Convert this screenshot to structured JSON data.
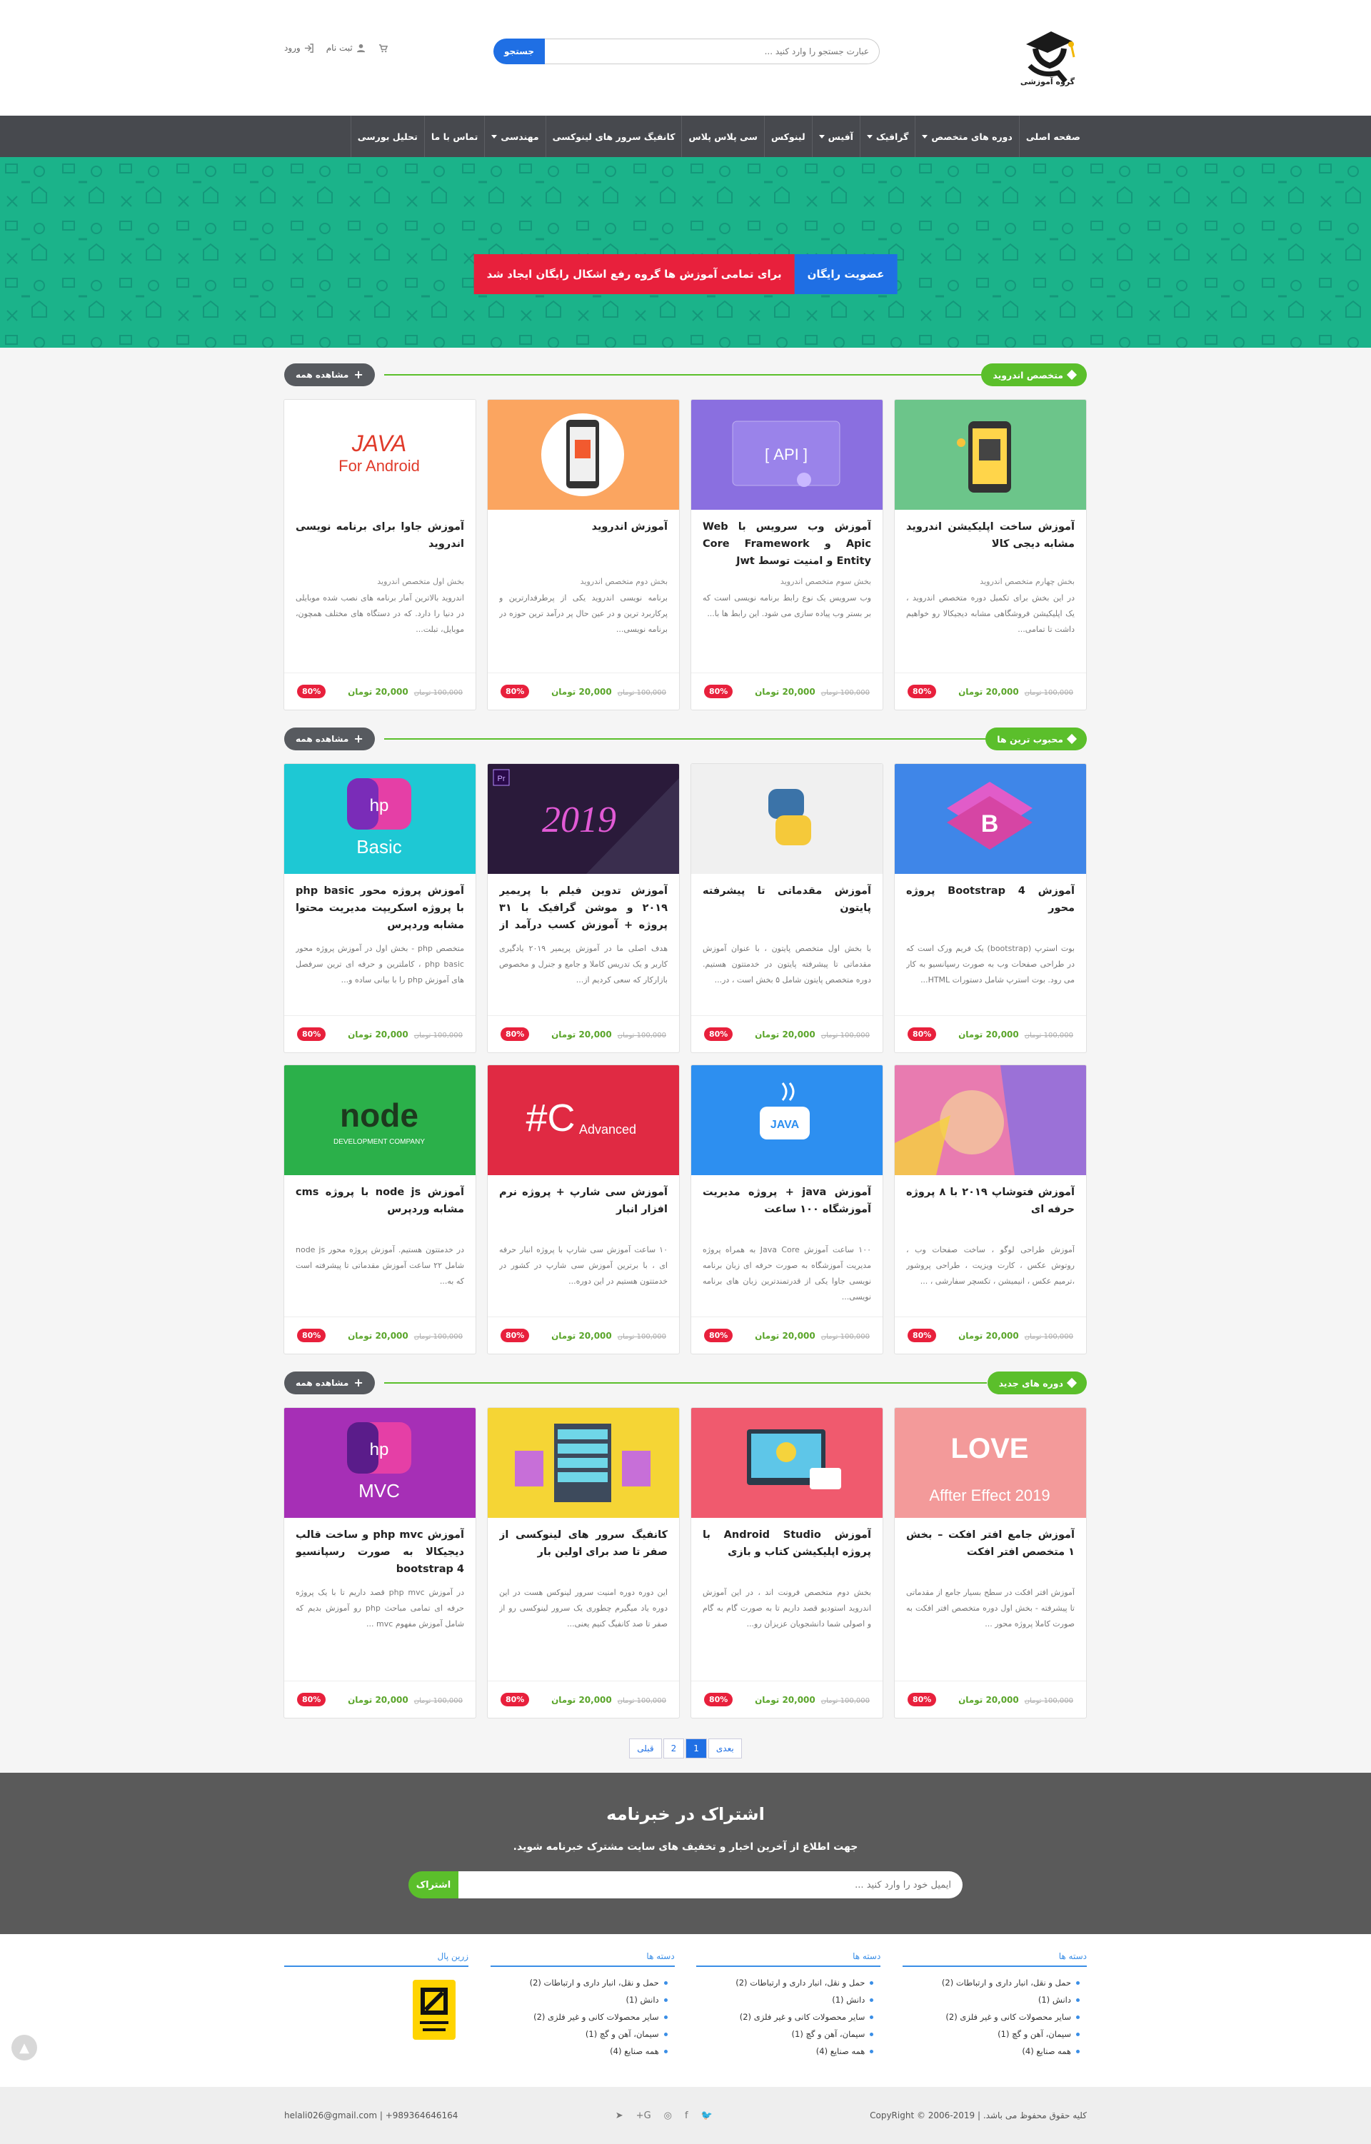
{
  "header": {
    "logo_text": "گروه آموزشی",
    "search_placeholder": "عبارت جستجو را وارد کنید ...",
    "search_button": "جستجو",
    "login": "ورود",
    "register": "ثبت نام"
  },
  "nav": [
    {
      "label": "صفحه اصلی",
      "dropdown": false
    },
    {
      "label": "دوره های متخصص",
      "dropdown": true
    },
    {
      "label": "گرافیک",
      "dropdown": true
    },
    {
      "label": "آفیس",
      "dropdown": true
    },
    {
      "label": "لینوکس",
      "dropdown": false
    },
    {
      "label": "سی پلاس پلاس",
      "dropdown": false
    },
    {
      "label": "کانفیگ سرور های لینوکسی",
      "dropdown": false
    },
    {
      "label": "مهندسی",
      "dropdown": true
    },
    {
      "label": "تماس با ما",
      "dropdown": false
    },
    {
      "label": "تحلیل بورسی",
      "dropdown": false
    }
  ],
  "promo": {
    "text": "برای تمامی آموزش ها گروه رفع اشکال رایگان ایجاد شد",
    "button": "عضویت رایگان"
  },
  "view_all": "مشاهده همه",
  "sections": [
    {
      "title": "متخصص اندروید",
      "cards": [
        {
          "title": "آموزش ساخت اپلیکیشن اندروید مشابه دیجی کالا",
          "sub": "بخش چهارم متخصص اندروید",
          "desc": "در این بخش برای تکمیل دوره متخصص اندروید ، یک اپلیکیشن فروشگاهی مشابه دیجیکالا رو خواهیم داشت تا تمامی...",
          "badge": "80%",
          "old": "100,000 تومان",
          "price": "20,000 تومان",
          "img": "android",
          "bg": "#6cc58a"
        },
        {
          "title": "آموزش وب سرویس با Web Apic و Core Framework Entity و امنیت توسط Jwt",
          "sub": "بخش سوم متخصص اندروید",
          "desc": "وب سرویس یک نوع رابط برنامه نویسی است که بر بستر وب پیاده سازی می شود. این رابط ها با...",
          "badge": "80%",
          "old": "100,000 تومان",
          "price": "20,000 تومان",
          "img": "api",
          "bg": "#8a6fe0"
        },
        {
          "title": "آموزش اندروید",
          "sub": "بخش دوم متخصص اندروید",
          "desc": "برنامه نویسی اندروید یکی از پرطرفدارترین و پرکاربرد ترین و در عین حال پر درآمد ترین حوزه در برنامه نویسی...",
          "badge": "80%",
          "old": "100,000 تومان",
          "price": "20,000 تومان",
          "img": "phone",
          "bg": "#fba560"
        },
        {
          "title": "آموزش جاوا برای برنامه نویسی اندروید",
          "sub": "بخش اول متخصص اندروید",
          "desc": "اندروید بالاترین آمار برنامه های نصب شده موبایلی در دنیا را دارد. که در دستگاه های مختلف همچون، موبایل، تبلت...",
          "badge": "80%",
          "old": "100,000 تومان",
          "price": "20,000 تومان",
          "img": "java",
          "bg": "#ffffff"
        }
      ]
    },
    {
      "title": "محبوب ترین ها",
      "cards": [
        {
          "title": "آموزش Bootstrap 4 پروژه محور",
          "sub": "",
          "desc": "بوت استرپ (bootstrap) یک فریم ورک است که در طراحی صفحات وب به صورت رسپانسیو به کار می رود. بوت استرپ شامل دستورات HTML...",
          "badge": "80%",
          "old": "100,000 تومان",
          "price": "20,000 تومان",
          "img": "bootstrap",
          "bg": "#3f86e8"
        },
        {
          "title": "آموزش مقدماتی تا پیشرفته پایتون",
          "sub": "",
          "desc": "با بخش اول متخصص پایتون ، با عنوان آموزش مقدماتی تا پیشرفته پایتون در خدمتتون هستیم. دوره متخصص پایتون شامل ۵ بخش است ، در...",
          "badge": "80%",
          "old": "100,000 تومان",
          "price": "20,000 تومان",
          "img": "python",
          "bg": "#f0f0f0"
        },
        {
          "title": "آموزش تدوین فیلم با پریمیر ۲۰۱۹ و موشن گرافیک با ۳۱ پروژه + آموزش کسب درآمد از اینترنت",
          "sub": "",
          "desc": "هدف اصلی ما در آموزش پریمیر ۲۰۱۹ یادگیری کاربر و یک تدریس کاملا و جامع و جنرل و مخصوص بازارکار که سعی کردیم از...",
          "badge": "80%",
          "old": "100,000 تومان",
          "price": "20,000 تومان",
          "img": "premiere",
          "bg": "#2a1a3a"
        },
        {
          "title": "آموزش پروژه محور php basic با پروژه اسکریپت مدیریت محتوا مشابه وردپرس",
          "sub": "",
          "desc": "متخصص php - بخش اول در آموزش پروژه محور php basic ، کاملترین و حرفه ای ترین سرفصل های آموزش php را با بیانی ساده و...",
          "badge": "80%",
          "old": "100,000 تومان",
          "price": "20,000 تومان",
          "img": "phpbasic",
          "bg": "#1ec8d4"
        },
        {
          "title": "آموزش فتوشاپ ۲۰۱۹ با ۸ پروژه حرفه ای",
          "sub": "",
          "desc": "آموزش طراحی لوگو ، ساخت صفحات وب ، روتوش عکس ، کارت ویزیت ، طراحی پروشور ،ترمیم عکس ، انیمیشن ، تکسچر سفارشی ، ...",
          "badge": "80%",
          "old": "100,000 تومان",
          "price": "20,000 تومان",
          "img": "photoshop",
          "bg": "#e87bb0"
        },
        {
          "title": "آموزش java + پروژه مدیریت آموزشگاه ۱۰۰ ساعت",
          "sub": "",
          "desc": "۱۰۰ ساعت آموزش Java Core به همراه پروژه مدیریت آموزشگاه به صورت حرفه ای زبان برنامه نویسی جاوا یکی از قدرتمندترین زبان های برنامه نویسی...",
          "badge": "80%",
          "old": "100,000 تومان",
          "price": "20,000 تومان",
          "img": "javacup",
          "bg": "#2d8ff0"
        },
        {
          "title": "آموزش سی شارپ + پروژه نرم افزار انبار",
          "sub": "",
          "desc": "۱۰ ساعت آموزش سی شارپ با پروژه انبار حرفه ای ، با برترین آموزش سی شارپ در کشور در خدمتتون هستیم در این دوره...",
          "badge": "80%",
          "old": "100,000 تومان",
          "price": "20,000 تومان",
          "img": "csharp",
          "bg": "#e02a43"
        },
        {
          "title": "آموزش node js با پروژه cms مشابه وردپرس",
          "sub": "",
          "desc": "در خدمتتون هستیم. آموزش پروژه محور node js شامل ۲۲ ساعت آموزش مقدماتی تا پیشرفته است که به...",
          "badge": "80%",
          "old": "100,000 تومان",
          "price": "20,000 تومان",
          "img": "node",
          "bg": "#2bb04a"
        }
      ]
    },
    {
      "title": "دوره های جدید",
      "cards": [
        {
          "title": "آموزش جامع افتر افکت – بخش ۱ متخصص افتر افکت",
          "sub": "",
          "desc": "آموزش افتر افکت در سطح بسیار جامع از مقدماتی تا پیشرفته - بخش اول دوره متخصص افتر افکت به صورت کاملا پروژه محور ...",
          "badge": "80%",
          "old": "100,000 تومان",
          "price": "20,000 تومان",
          "img": "ae",
          "bg": "#f39a9a"
        },
        {
          "title": "آموزش Android Studio با پروژه اپلیکیشن کتاب و بازی",
          "sub": "",
          "desc": "بخش دوم متخصص فرونت اند ، در این آموزش اندروید استودیو قصد داریم تا به صورت گام به گام و اصولی شما دانشجویان عزیزان رو...",
          "badge": "80%",
          "old": "100,000 تومان",
          "price": "20,000 تومان",
          "img": "studio",
          "bg": "#f05a6e"
        },
        {
          "title": "کانفیگ سرور های لینوکسی از صفر تا صد برای اولین بار",
          "sub": "",
          "desc": "این دوره دوره امنیت سرور لینوکس هست در این دوره یاد میگیرم چطوری یک سرور لینوکسی رو از صفر تا صد کانفیگ کنیم یعنی...",
          "badge": "80%",
          "old": "100,000 تومان",
          "price": "20,000 تومان",
          "img": "server",
          "bg": "#f5d535"
        },
        {
          "title": "آموزش php mvc و ساخت قالب دیجیکالا به صورت رسپانسیو bootstrap 4",
          "sub": "",
          "desc": "در آموزش php mvc قصد داریم تا با یک پروژه حرفه ای تمامی مباحث php رو آموزش بدیم که شامل آموزش مفهوم mvc ...",
          "badge": "80%",
          "old": "100,000 تومان",
          "price": "20,000 تومان",
          "img": "phpmvc",
          "bg": "#a62fb6"
        }
      ]
    }
  ],
  "pager": {
    "next": "بعدی",
    "p1": "1",
    "p2": "2",
    "prev": "قبلی"
  },
  "newsletter": {
    "title": "اشتراک در خبرنامه",
    "desc": "جهت اطلاع از آخرین اخبار و تخفیف های سایت مشترک خبرنامه شوید.",
    "placeholder": "ایمیل خود را وارد کنید ...",
    "button": "اشتراک"
  },
  "footer_cols": [
    {
      "title": "دسته ها",
      "items": [
        "حمل و نقل، انبار داری و ارتباطات (2)",
        "دانش (1)",
        "سایر محصولات کانی و غیر فلزی (2)",
        "سیمان، آهن و گچ (1)",
        "همه صنایع (4)"
      ]
    },
    {
      "title": "دسته ها",
      "items": [
        "حمل و نقل، انبار داری و ارتباطات (2)",
        "دانش (1)",
        "سایر محصولات کانی و غیر فلزی (2)",
        "سیمان، آهن و گچ (1)",
        "همه صنایع (4)"
      ]
    },
    {
      "title": "دسته ها",
      "items": [
        "حمل و نقل، انبار داری و ارتباطات (2)",
        "دانش (1)",
        "سایر محصولات کانی و غیر فلزی (2)",
        "سیمان، آهن و گچ (1)",
        "همه صنایع (4)"
      ]
    },
    {
      "title": "زرین پال",
      "items": []
    }
  ],
  "footer": {
    "copyright": "کلیه حقوق محفوظ می باشد. | CopyRight © 2006-2019",
    "contact": "helali026@gmail.com | +989364646164"
  },
  "colors": {
    "green": "#5bbf2b",
    "red": "#e8203c",
    "blue": "#1f6fe4",
    "nav": "#47494e",
    "hero": "#1bb38a"
  }
}
